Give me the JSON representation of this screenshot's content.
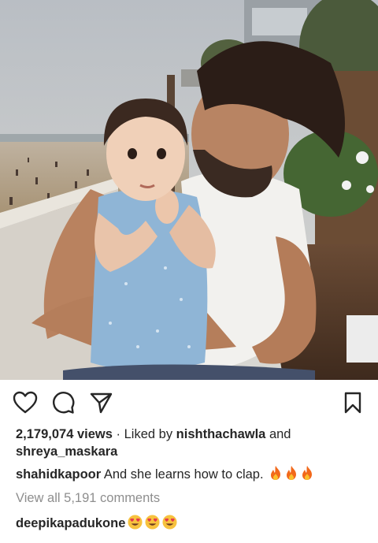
{
  "post": {
    "photo_alt": "man holding a baby on a seaside terrace",
    "views": "2,179,074 views",
    "separator": " · ",
    "liked_by_prefix": "Liked by ",
    "liked_by_user": "nishthachawla",
    "liked_by_and": " and",
    "liked_by_user2": "shreya_maskara",
    "caption_user": "shahidkapoor",
    "caption_text": " And she learns how to clap. ",
    "caption_emoji": [
      "fire-emoji",
      "fire-emoji",
      "fire-emoji"
    ],
    "view_all_comments": "View all 5,191 comments",
    "comment_user": "deepikapadukone",
    "comment_emoji": [
      "heart-eyes-emoji",
      "heart-eyes-emoji",
      "heart-eyes-emoji"
    ]
  },
  "icons": {
    "like": "heart-icon",
    "comment": "comment-bubble-icon",
    "share": "paper-plane-icon",
    "save": "bookmark-icon"
  },
  "colors": {
    "text": "#262626",
    "muted": "#8e8e8e",
    "fire": "#f2691b",
    "heart_eyes": "#f7c23e"
  }
}
